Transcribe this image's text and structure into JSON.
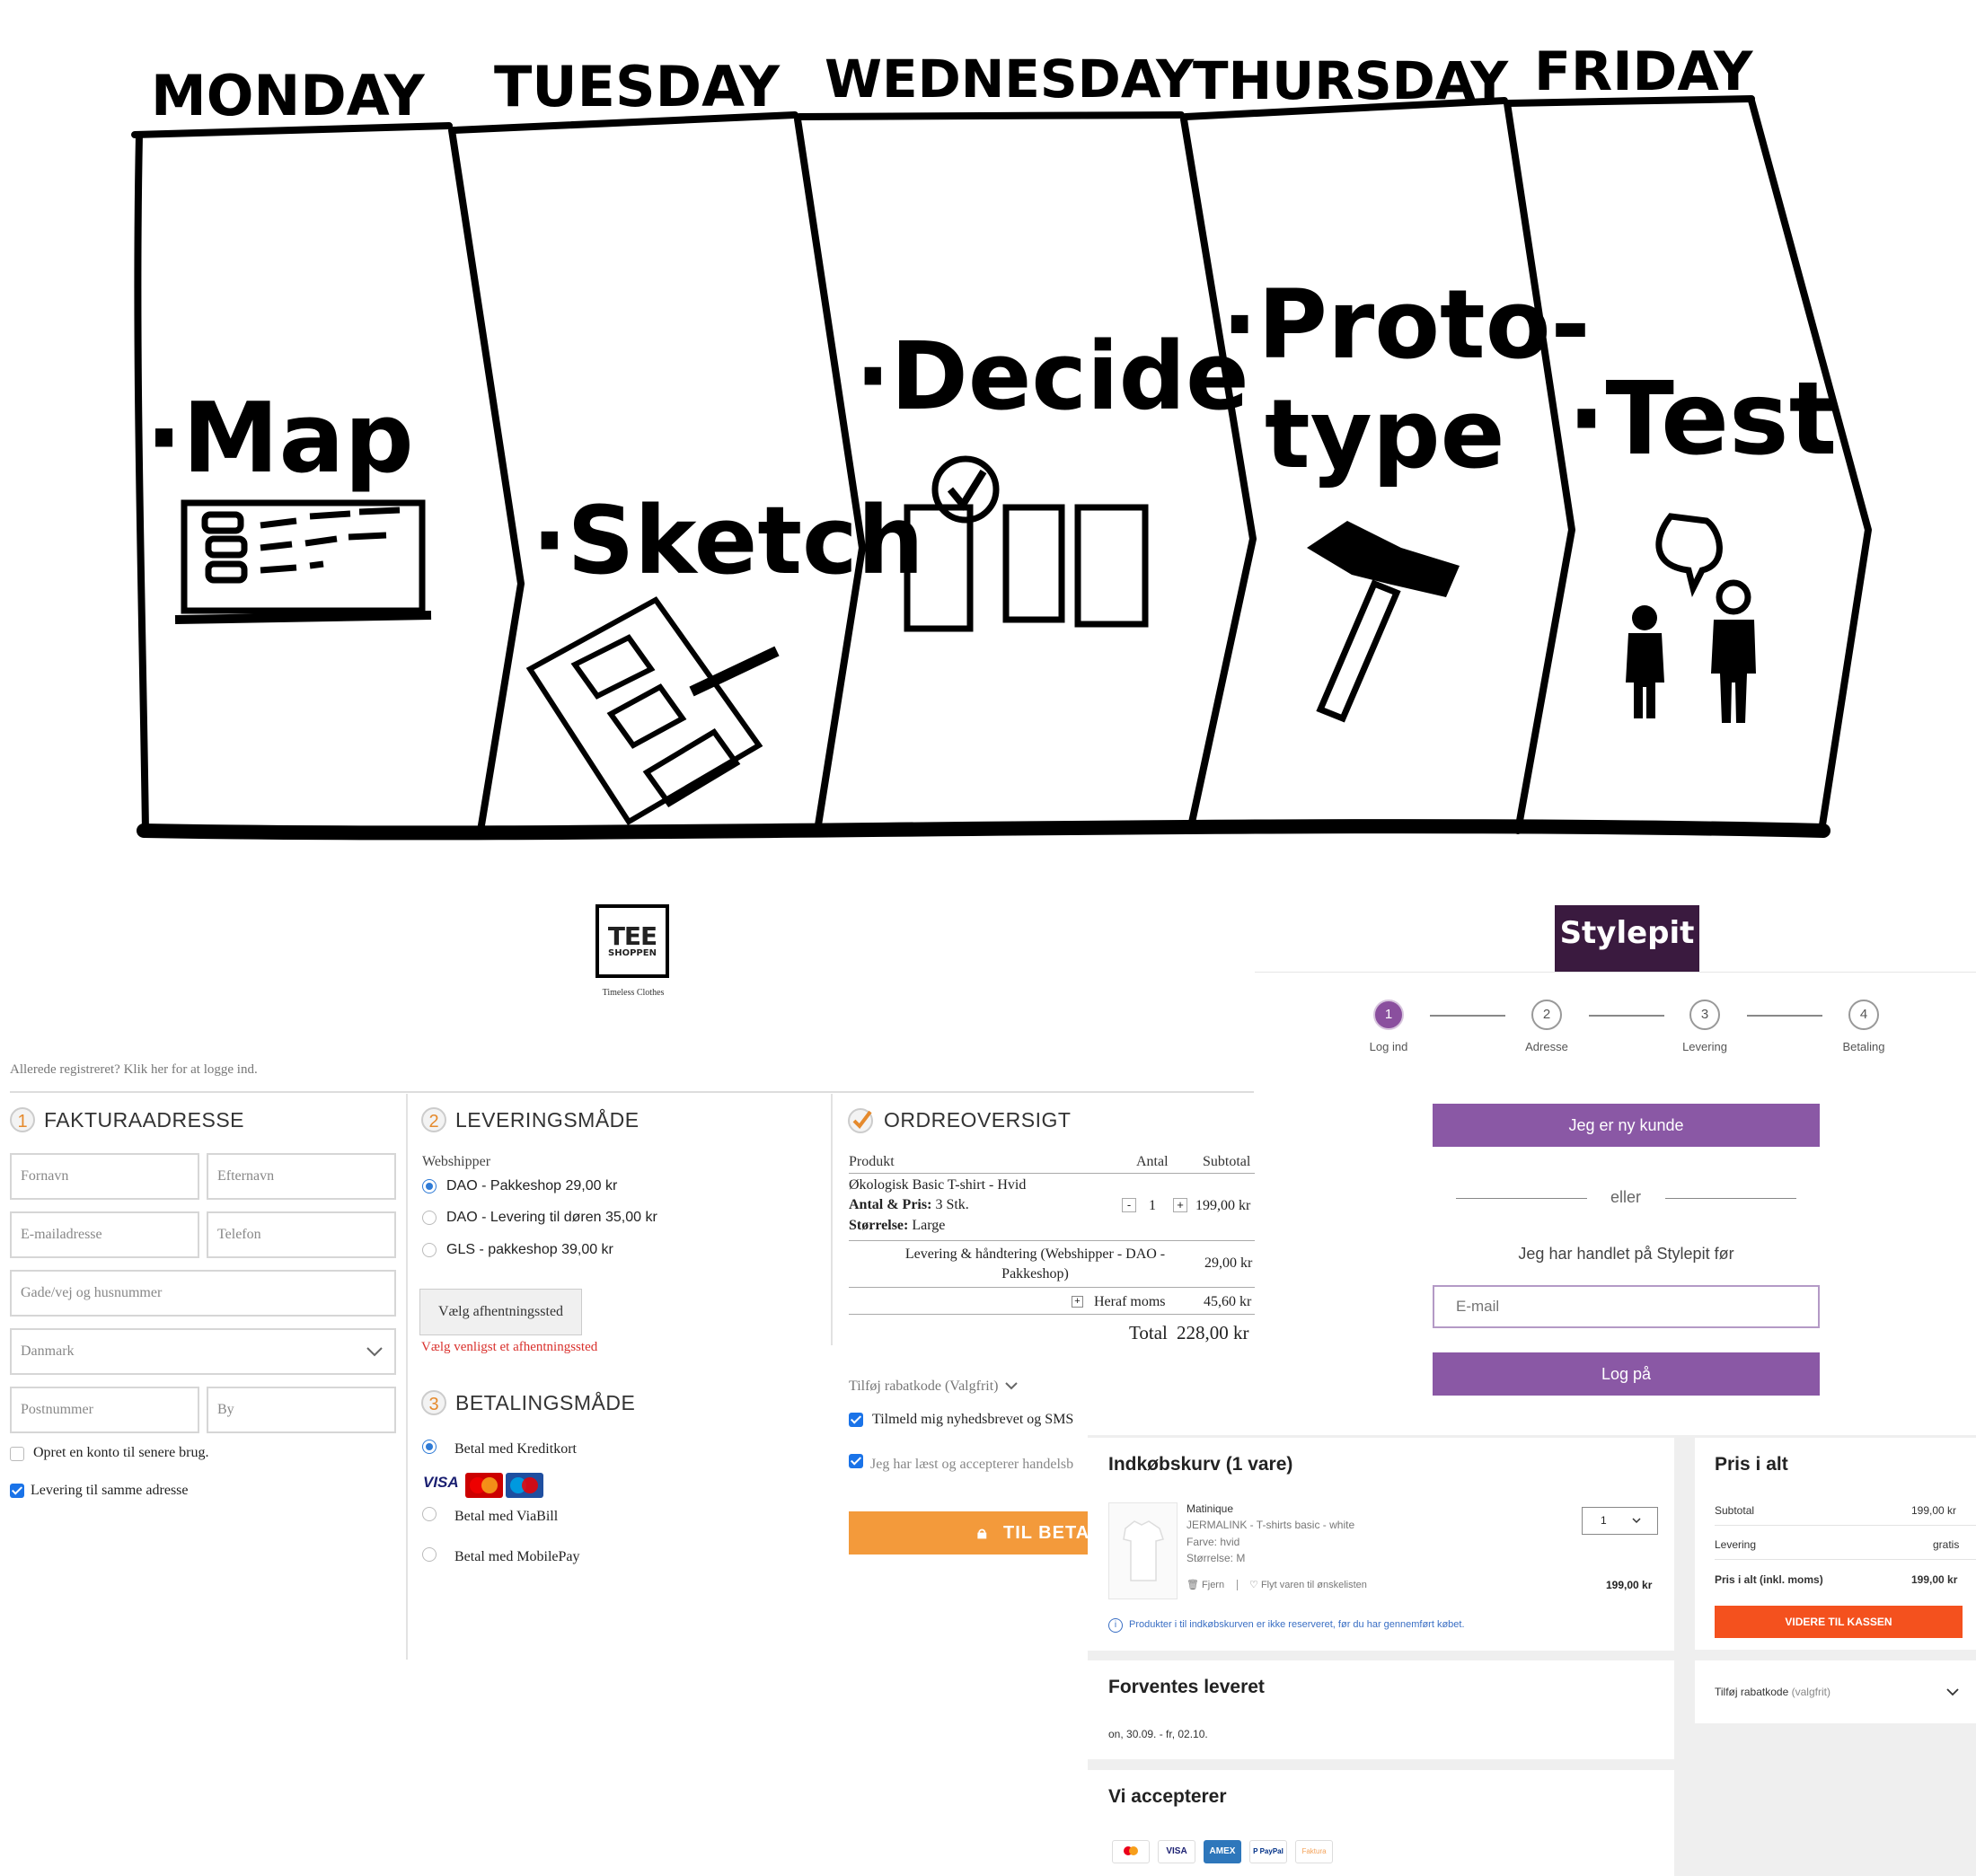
{
  "sprint": {
    "days": [
      "MONDAY",
      "TUESDAY",
      "WEDNESDAY",
      "THURSDAY",
      "FRIDAY"
    ],
    "stages": [
      "·Map",
      "·Sketch",
      "·Decide",
      "·Proto-",
      "type",
      "·Test"
    ]
  },
  "teeshoppen": {
    "logo_big": "TEE",
    "logo_small": "SHOPPEN",
    "tagline": "Timeless Clothes",
    "login_link": "Allerede registreret? Klik her for at logge ind.",
    "billing": {
      "num": "1",
      "title": "FAKTURAADRESSE",
      "first_name_placeholder": "Fornavn",
      "last_name_placeholder": "Efternavn",
      "email_placeholder": "E-mailadresse",
      "phone_placeholder": "Telefon",
      "street_placeholder": "Gade/vej og husnummer",
      "country_value": "Danmark",
      "zip_placeholder": "Postnummer",
      "city_placeholder": "By",
      "create_account_label": "Opret en konto til senere brug.",
      "same_address_label": "Levering til samme adresse"
    },
    "delivery": {
      "num": "2",
      "title": "LEVERINGSMÅDE",
      "group_label": "Webshipper",
      "options": [
        {
          "label": "DAO - Pakkeshop 29,00 kr",
          "selected": true
        },
        {
          "label": "DAO - Levering til døren 35,00 kr",
          "selected": false
        },
        {
          "label": "GLS - pakkeshop 39,00 kr",
          "selected": false
        }
      ],
      "pickup_button": "Vælg afhentningssted",
      "pickup_error": "Vælg venligst et afhentningssted"
    },
    "payment": {
      "num": "3",
      "title": "BETALINGSMÅDE",
      "options": [
        "Betal med Kreditkort",
        "Betal med ViaBill",
        "Betal med MobilePay"
      ],
      "card_logos": [
        "VISA",
        "MasterCard",
        "Maestro"
      ]
    },
    "order": {
      "title": "ORDREOVERSIGT",
      "col_product": "Produkt",
      "col_qty": "Antal",
      "col_subtotal": "Subtotal",
      "item_name": "Økologisk Basic T-shirt - Hvid",
      "item_qty_label": "Antal & Pris:",
      "item_qty_value": "3 Stk.",
      "item_size_label": "Størrelse:",
      "item_size_value": "Large",
      "qty_minus": "-",
      "qty": "1",
      "qty_plus": "+",
      "item_subtotal": "199,00 kr",
      "shipping_label": "Levering & håndtering (Webshipper - DAO - Pakkeshop)",
      "shipping_value": "29,00 kr",
      "vat_label": "Heraf moms",
      "vat_value": "45,60 kr",
      "total_label": "Total",
      "total_value": "228,00 kr",
      "discount_label": "Tilføj rabatkode (Valgfrit)",
      "newsletter_label": "Tilmeld mig nyhedsbrevet og SMS",
      "terms_label": "Jeg har læst og accepterer handelsb",
      "pay_button": "TIL BETAL"
    }
  },
  "stylepit": {
    "logo": "Stylepit",
    "steps": [
      {
        "num": "1",
        "label": "Log ind"
      },
      {
        "num": "2",
        "label": "Adresse"
      },
      {
        "num": "3",
        "label": "Levering"
      },
      {
        "num": "4",
        "label": "Betaling"
      }
    ],
    "new_customer_button": "Jeg er ny kunde",
    "or_text": "eller",
    "returning_text": "Jeg har handlet på Stylepit før",
    "email_placeholder": "E-mail",
    "login_button": "Log på",
    "cart": {
      "title": "Indkøbskurv (1 vare)",
      "brand": "Matinique",
      "product": "JERMALINK - T-shirts basic - white",
      "color": "Farve: hvid",
      "size": "Størrelse: M",
      "qty": "1",
      "remove": "Fjern",
      "wishlist": "Flyt varen til ønskelisten",
      "price": "199,00 kr",
      "notice": "Produkter i til indkøbskurven er ikke reserveret, før du har gennemført købet."
    },
    "delivery_card": {
      "title": "Forventes leveret",
      "dates": "on, 30.09. - fr, 02.10."
    },
    "accept_card": {
      "title": "Vi accepterer",
      "icons": [
        "mastercard-icon",
        "visa-icon",
        "amex-icon",
        "paypal-icon",
        "faktura-icon"
      ],
      "labels": [
        "",
        "VISA",
        "AMEX",
        "P PayPal",
        "Faktura"
      ]
    },
    "summary": {
      "title": "Pris i alt",
      "subtotal_label": "Subtotal",
      "subtotal_value": "199,00 kr",
      "delivery_label": "Levering",
      "delivery_value": "gratis",
      "total_label": "Pris i alt (inkl. moms)",
      "total_value": "199,00 kr",
      "checkout_button": "VIDERE TIL KASSEN",
      "discount_label": "Tilføj rabatkode",
      "discount_optional": "(valgfrit)"
    }
  },
  "colors": {
    "teeshoppen_accent": "#f39a3b",
    "error_red": "#d9302c",
    "stylepit_purple": "#8a58a5",
    "stylepit_logo_bg": "#3a1a3f",
    "stylepit_orange": "#f4511e"
  }
}
